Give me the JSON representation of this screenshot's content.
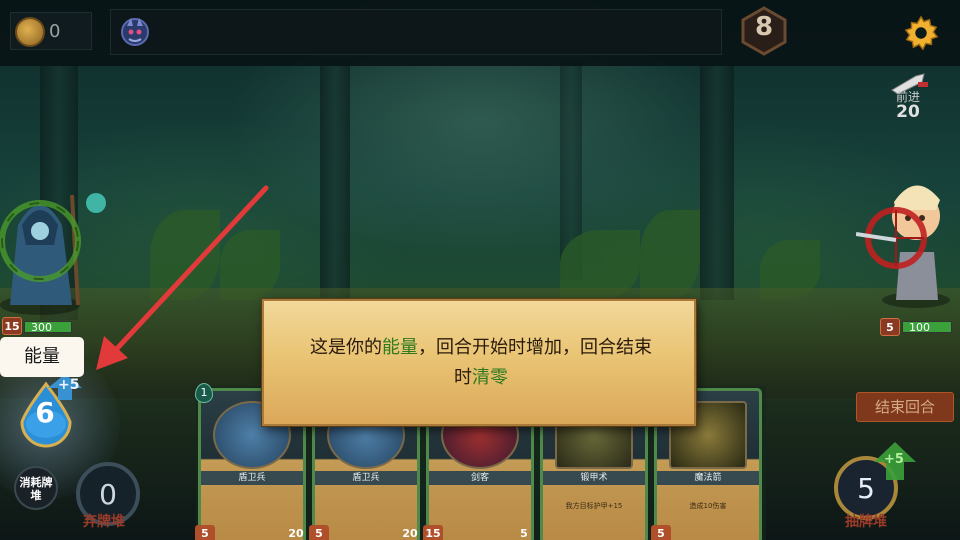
{
  "topbar": {
    "coins": "0",
    "turn": "8"
  },
  "enemy_intent": {
    "label": "前进",
    "value": "20"
  },
  "hero": {
    "shield": "15",
    "hp": "300",
    "hp_fraction": 1.0
  },
  "enemy": {
    "shield": "5",
    "hp": "100",
    "hp_fraction": 1.0
  },
  "tutorial": {
    "line1_pre": "这是你的",
    "line1_hl": "能量",
    "line1_post": "，回合开始时增加，回合结束",
    "line2_pre": "时",
    "line2_hl": "清零"
  },
  "energy": {
    "label": "能量",
    "value": "6",
    "gain": "+5"
  },
  "piles": {
    "exhaust_label": "消耗牌堆",
    "discard_count": "0",
    "discard_label": "弃牌堆",
    "draw_count": "5",
    "draw_label": "抽牌堆",
    "draw_gain": "+5"
  },
  "end_turn_label": "结束回合",
  "cards": [
    {
      "name": "盾卫兵",
      "energy": "1",
      "cost": "5",
      "atk": "20",
      "desc": ""
    },
    {
      "name": "盾卫兵",
      "energy": "",
      "cost": "5",
      "atk": "20",
      "desc": ""
    },
    {
      "name": "剑客",
      "energy": "",
      "cost": "15",
      "atk": "5",
      "desc": ""
    },
    {
      "name": "锻甲术",
      "energy": "",
      "cost": "",
      "atk": "",
      "desc": "我方目标护甲+15"
    },
    {
      "name": "魔法箭",
      "energy": "",
      "cost": "5",
      "atk": "",
      "desc": "造成10伤害"
    }
  ],
  "colors": {
    "highlight_text": "#2f7a1e",
    "arrow": "#e23a3a",
    "end_turn_bg": "#8a3a1c",
    "card_border": "#4f8a4a"
  }
}
